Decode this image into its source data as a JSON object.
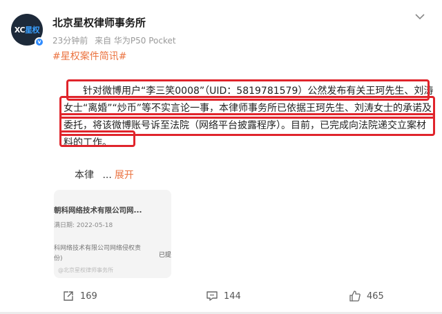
{
  "post": {
    "author": "北京星权律师事务所",
    "avatar_text": "XC",
    "avatar_text_accent": "星权",
    "time": "23分钟前",
    "source": "来自 华为P50 Pocket",
    "topic": "#星权案件简讯#",
    "body_line1": "针对微博用户“李三笑0008”（UID：5819781579）公然发布有关王珂先生、刘涛",
    "body_line2": "女士“离婚”“炒币”等不实言论一事，本律师事务所已依据王珂先生、刘涛女士的承诺及",
    "body_line3": "委托，将该微博账号诉至法院（网络平台披露程序）。目前，已完成向法院递交立案材",
    "body_line4": "料的工作。",
    "collapsed_prefix": "本律",
    "ellipsis": "...",
    "expand_label": "展开"
  },
  "attachment": {
    "title": "朝科网络技术有限公司网...",
    "date": "满日期: 2022-05-18",
    "line1": "科网络技术有限公司网络侵权责",
    "line2": "份)",
    "watermark": "@北京星权律师事务所",
    "side_tag": "已提"
  },
  "actions": {
    "share_count": "169",
    "comment_count": "144",
    "like_count": "465"
  },
  "icons": {
    "share": "share-icon",
    "comment": "comment-icon",
    "like": "like-icon",
    "more": "chevron-down-icon",
    "verified": "verified-badge-icon"
  },
  "colors": {
    "topic": "#eb7340",
    "highlight_box": "#e0242b",
    "verified": "#2f8cff"
  }
}
